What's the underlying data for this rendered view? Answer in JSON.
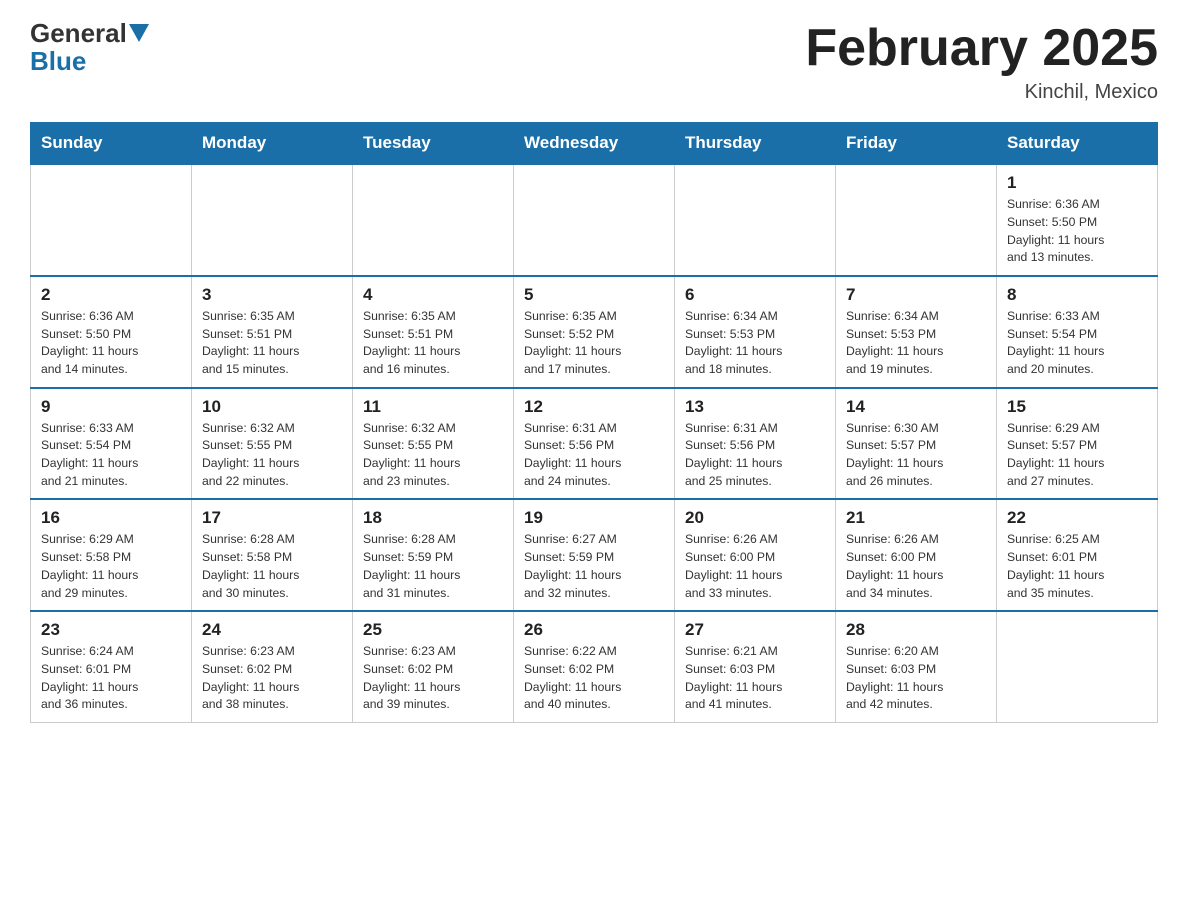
{
  "header": {
    "logo_general": "General",
    "logo_blue": "Blue",
    "title": "February 2025",
    "location": "Kinchil, Mexico"
  },
  "days_of_week": [
    "Sunday",
    "Monday",
    "Tuesday",
    "Wednesday",
    "Thursday",
    "Friday",
    "Saturday"
  ],
  "weeks": [
    [
      {
        "day": "",
        "info": ""
      },
      {
        "day": "",
        "info": ""
      },
      {
        "day": "",
        "info": ""
      },
      {
        "day": "",
        "info": ""
      },
      {
        "day": "",
        "info": ""
      },
      {
        "day": "",
        "info": ""
      },
      {
        "day": "1",
        "info": "Sunrise: 6:36 AM\nSunset: 5:50 PM\nDaylight: 11 hours\nand 13 minutes."
      }
    ],
    [
      {
        "day": "2",
        "info": "Sunrise: 6:36 AM\nSunset: 5:50 PM\nDaylight: 11 hours\nand 14 minutes."
      },
      {
        "day": "3",
        "info": "Sunrise: 6:35 AM\nSunset: 5:51 PM\nDaylight: 11 hours\nand 15 minutes."
      },
      {
        "day": "4",
        "info": "Sunrise: 6:35 AM\nSunset: 5:51 PM\nDaylight: 11 hours\nand 16 minutes."
      },
      {
        "day": "5",
        "info": "Sunrise: 6:35 AM\nSunset: 5:52 PM\nDaylight: 11 hours\nand 17 minutes."
      },
      {
        "day": "6",
        "info": "Sunrise: 6:34 AM\nSunset: 5:53 PM\nDaylight: 11 hours\nand 18 minutes."
      },
      {
        "day": "7",
        "info": "Sunrise: 6:34 AM\nSunset: 5:53 PM\nDaylight: 11 hours\nand 19 minutes."
      },
      {
        "day": "8",
        "info": "Sunrise: 6:33 AM\nSunset: 5:54 PM\nDaylight: 11 hours\nand 20 minutes."
      }
    ],
    [
      {
        "day": "9",
        "info": "Sunrise: 6:33 AM\nSunset: 5:54 PM\nDaylight: 11 hours\nand 21 minutes."
      },
      {
        "day": "10",
        "info": "Sunrise: 6:32 AM\nSunset: 5:55 PM\nDaylight: 11 hours\nand 22 minutes."
      },
      {
        "day": "11",
        "info": "Sunrise: 6:32 AM\nSunset: 5:55 PM\nDaylight: 11 hours\nand 23 minutes."
      },
      {
        "day": "12",
        "info": "Sunrise: 6:31 AM\nSunset: 5:56 PM\nDaylight: 11 hours\nand 24 minutes."
      },
      {
        "day": "13",
        "info": "Sunrise: 6:31 AM\nSunset: 5:56 PM\nDaylight: 11 hours\nand 25 minutes."
      },
      {
        "day": "14",
        "info": "Sunrise: 6:30 AM\nSunset: 5:57 PM\nDaylight: 11 hours\nand 26 minutes."
      },
      {
        "day": "15",
        "info": "Sunrise: 6:29 AM\nSunset: 5:57 PM\nDaylight: 11 hours\nand 27 minutes."
      }
    ],
    [
      {
        "day": "16",
        "info": "Sunrise: 6:29 AM\nSunset: 5:58 PM\nDaylight: 11 hours\nand 29 minutes."
      },
      {
        "day": "17",
        "info": "Sunrise: 6:28 AM\nSunset: 5:58 PM\nDaylight: 11 hours\nand 30 minutes."
      },
      {
        "day": "18",
        "info": "Sunrise: 6:28 AM\nSunset: 5:59 PM\nDaylight: 11 hours\nand 31 minutes."
      },
      {
        "day": "19",
        "info": "Sunrise: 6:27 AM\nSunset: 5:59 PM\nDaylight: 11 hours\nand 32 minutes."
      },
      {
        "day": "20",
        "info": "Sunrise: 6:26 AM\nSunset: 6:00 PM\nDaylight: 11 hours\nand 33 minutes."
      },
      {
        "day": "21",
        "info": "Sunrise: 6:26 AM\nSunset: 6:00 PM\nDaylight: 11 hours\nand 34 minutes."
      },
      {
        "day": "22",
        "info": "Sunrise: 6:25 AM\nSunset: 6:01 PM\nDaylight: 11 hours\nand 35 minutes."
      }
    ],
    [
      {
        "day": "23",
        "info": "Sunrise: 6:24 AM\nSunset: 6:01 PM\nDaylight: 11 hours\nand 36 minutes."
      },
      {
        "day": "24",
        "info": "Sunrise: 6:23 AM\nSunset: 6:02 PM\nDaylight: 11 hours\nand 38 minutes."
      },
      {
        "day": "25",
        "info": "Sunrise: 6:23 AM\nSunset: 6:02 PM\nDaylight: 11 hours\nand 39 minutes."
      },
      {
        "day": "26",
        "info": "Sunrise: 6:22 AM\nSunset: 6:02 PM\nDaylight: 11 hours\nand 40 minutes."
      },
      {
        "day": "27",
        "info": "Sunrise: 6:21 AM\nSunset: 6:03 PM\nDaylight: 11 hours\nand 41 minutes."
      },
      {
        "day": "28",
        "info": "Sunrise: 6:20 AM\nSunset: 6:03 PM\nDaylight: 11 hours\nand 42 minutes."
      },
      {
        "day": "",
        "info": ""
      }
    ]
  ]
}
